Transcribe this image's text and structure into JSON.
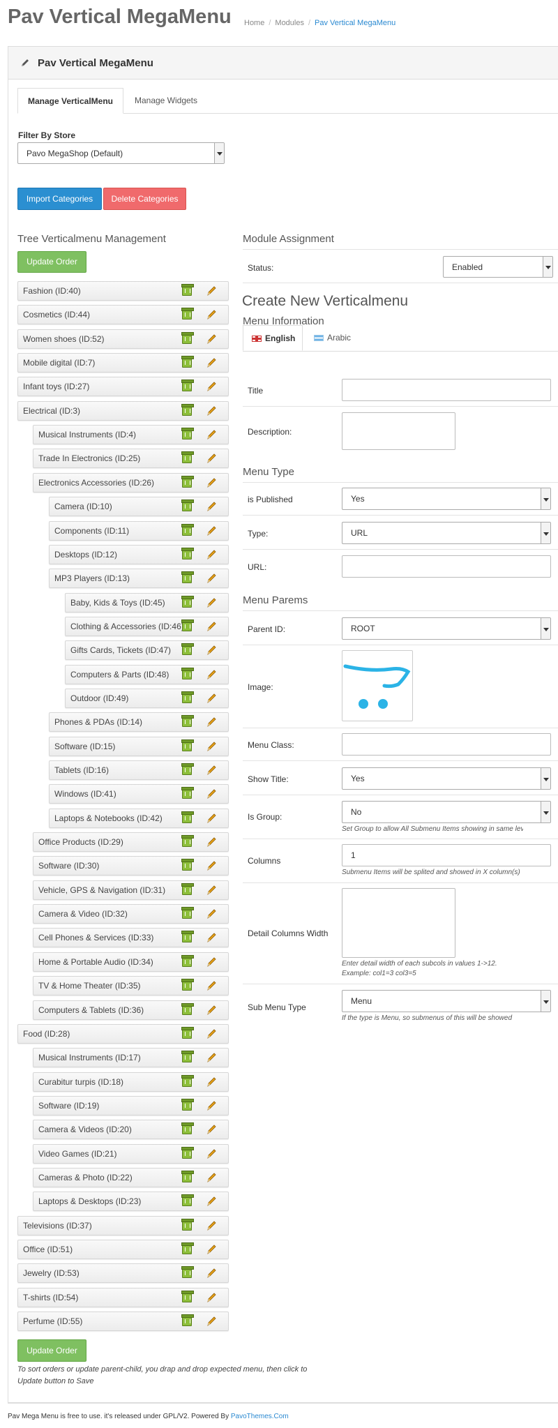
{
  "page": {
    "title": "Pav Vertical MegaMenu"
  },
  "breadcrumb": [
    "Home",
    "Modules",
    "Pav Vertical MegaMenu"
  ],
  "panel": {
    "title": "Pav Vertical MegaMenu",
    "icon": "pencil-icon"
  },
  "tabs": [
    {
      "label": "Manage VerticalMenu",
      "active": true
    },
    {
      "label": "Manage Widgets",
      "active": false
    }
  ],
  "filter": {
    "label": "Filter By Store",
    "value": "Pavo MegaShop (Default)"
  },
  "buttons": {
    "import": "Import Categories",
    "delete": "Delete Categories",
    "update_top": "Update Order",
    "update_bottom": "Update Order"
  },
  "tree": {
    "title": "Tree Verticalmenu Management",
    "note": "To sort orders or update parent-child, you drap and drop expected menu, then click to Update button to Save",
    "nodes": [
      {
        "label": "Fashion (ID:40)",
        "level": 0
      },
      {
        "label": "Cosmetics (ID:44)",
        "level": 0
      },
      {
        "label": "Women shoes (ID:52)",
        "level": 0
      },
      {
        "label": "Mobile digital (ID:7)",
        "level": 0
      },
      {
        "label": "Infant toys (ID:27)",
        "level": 0
      },
      {
        "label": "Electrical (ID:3)",
        "level": 0
      },
      {
        "label": "Musical Instruments (ID:4)",
        "level": 1
      },
      {
        "label": "Trade In Electronics (ID:25)",
        "level": 1
      },
      {
        "label": "Electronics Accessories (ID:26)",
        "level": 1
      },
      {
        "label": "Camera (ID:10)",
        "level": 2
      },
      {
        "label": "Components (ID:11)",
        "level": 2
      },
      {
        "label": "Desktops (ID:12)",
        "level": 2
      },
      {
        "label": "MP3 Players (ID:13)",
        "level": 2
      },
      {
        "label": "Baby, Kids & Toys (ID:45)",
        "level": 3
      },
      {
        "label": "Clothing & Accessories (ID:46)",
        "level": 3
      },
      {
        "label": "Gifts Cards, Tickets (ID:47)",
        "level": 3
      },
      {
        "label": "Computers & Parts (ID:48)",
        "level": 3
      },
      {
        "label": "Outdoor (ID:49)",
        "level": 3
      },
      {
        "label": "Phones & PDAs (ID:14)",
        "level": 2
      },
      {
        "label": "Software (ID:15)",
        "level": 2
      },
      {
        "label": "Tablets (ID:16)",
        "level": 2
      },
      {
        "label": "Windows (ID:41)",
        "level": 2
      },
      {
        "label": "Laptops & Notebooks (ID:42)",
        "level": 2
      },
      {
        "label": "Office Products (ID:29)",
        "level": 1
      },
      {
        "label": "Software (ID:30)",
        "level": 1
      },
      {
        "label": "Vehicle, GPS & Navigation (ID:31)",
        "level": 1
      },
      {
        "label": "Camera & Video (ID:32)",
        "level": 1
      },
      {
        "label": "Cell Phones & Services (ID:33)",
        "level": 1
      },
      {
        "label": "Home & Portable Audio (ID:34)",
        "level": 1
      },
      {
        "label": "TV & Home Theater (ID:35)",
        "level": 1
      },
      {
        "label": "Computers & Tablets (ID:36)",
        "level": 1
      },
      {
        "label": "Food (ID:28)",
        "level": 0
      },
      {
        "label": "Musical Instruments (ID:17)",
        "level": 1
      },
      {
        "label": "Curabitur turpis (ID:18)",
        "level": 1
      },
      {
        "label": "Software (ID:19)",
        "level": 1
      },
      {
        "label": "Camera & Videos (ID:20)",
        "level": 1
      },
      {
        "label": "Video Games (ID:21)",
        "level": 1
      },
      {
        "label": "Cameras & Photo (ID:22)",
        "level": 1
      },
      {
        "label": "Laptops & Desktops (ID:23)",
        "level": 1
      },
      {
        "label": "Televisions (ID:37)",
        "level": 0
      },
      {
        "label": "Office (ID:51)",
        "level": 0
      },
      {
        "label": "Jewelry (ID:53)",
        "level": 0
      },
      {
        "label": "T-shirts (ID:54)",
        "level": 0
      },
      {
        "label": "Perfume (ID:55)",
        "level": 0
      }
    ]
  },
  "assignment": {
    "title": "Module Assignment",
    "status_label": "Status:",
    "status_value": "Enabled"
  },
  "form": {
    "title": "Create New Verticalmenu",
    "menu_info": "Menu Information",
    "lang_tabs": [
      "English",
      "Arabic"
    ],
    "title_label": "Title",
    "title_value": "",
    "description_label": "Description:",
    "menu_type": "Menu Type",
    "published_label": "is Published",
    "published_value": "Yes",
    "type_label": "Type:",
    "type_value": "URL",
    "url_label": "URL:",
    "url_value": "",
    "menu_params": "Menu Parems",
    "parent_label": "Parent ID:",
    "parent_value": "ROOT",
    "image_label": "Image:",
    "menu_class_label": "Menu Class:",
    "menu_class_value": "",
    "show_title_label": "Show Title:",
    "show_title_value": "Yes",
    "is_group_label": "Is Group:",
    "is_group_value": "No",
    "is_group_help": "Set Group to allow All Submenu Items showing in same lev",
    "columns_label": "Columns",
    "columns_value": "1",
    "columns_help": "Submenu Items will be splited and showed in X column(s)",
    "detail_label": "Detail Columns Width",
    "detail_help_1": "Enter detail width of each subcols in values 1->12.",
    "detail_help_2": "Example: col1=3 col3=5",
    "submenu_label": "Sub Menu Type",
    "submenu_value": "Menu",
    "submenu_help": "If the type is Menu, so submenus of this will be showed"
  },
  "footer": {
    "text": "Pav Mega Menu is free to use. it's released under GPL/V2. Powered By ",
    "link": "PavoThemes.Com"
  },
  "colors": {
    "accent": "#2a89d1",
    "import_btn": "#2b8fd1",
    "delete_btn": "#f06a6c",
    "update_btn": "#7fc061"
  }
}
